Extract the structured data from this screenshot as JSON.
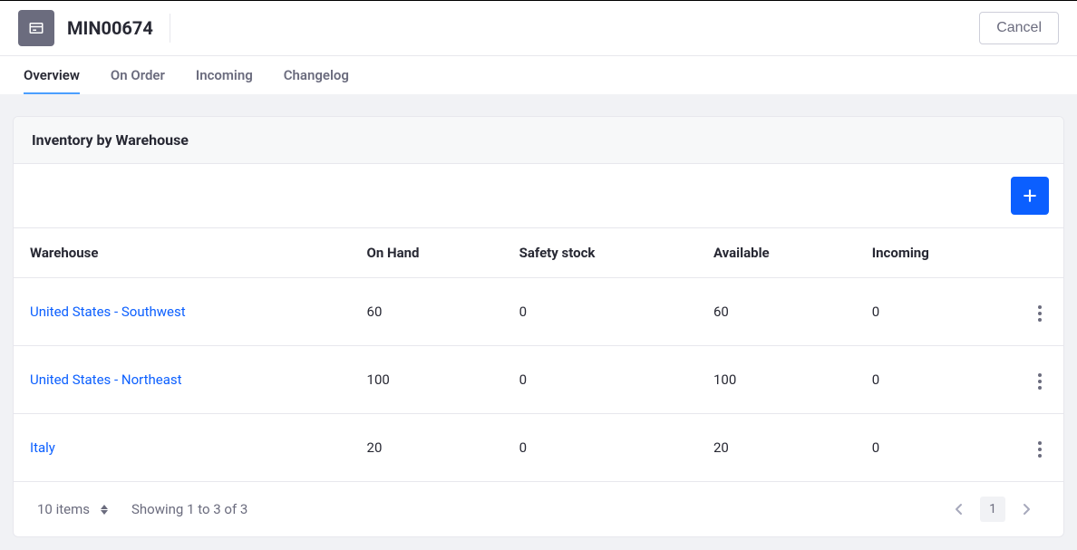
{
  "header": {
    "title": "MIN00674",
    "cancel_label": "Cancel"
  },
  "tabs": [
    {
      "label": "Overview",
      "active": true
    },
    {
      "label": "On Order",
      "active": false
    },
    {
      "label": "Incoming",
      "active": false
    },
    {
      "label": "Changelog",
      "active": false
    }
  ],
  "card": {
    "title": "Inventory by Warehouse"
  },
  "table": {
    "columns": [
      "Warehouse",
      "On Hand",
      "Safety stock",
      "Available",
      "Incoming"
    ],
    "rows": [
      {
        "warehouse": "United States - Southwest",
        "on_hand": "60",
        "safety_stock": "0",
        "available": "60",
        "incoming": "0"
      },
      {
        "warehouse": "United States - Northeast",
        "on_hand": "100",
        "safety_stock": "0",
        "available": "100",
        "incoming": "0"
      },
      {
        "warehouse": "Italy",
        "on_hand": "20",
        "safety_stock": "0",
        "available": "20",
        "incoming": "0"
      }
    ]
  },
  "footer": {
    "page_size_label": "10 items",
    "showing_label": "Showing 1 to 3 of 3",
    "current_page": "1"
  }
}
